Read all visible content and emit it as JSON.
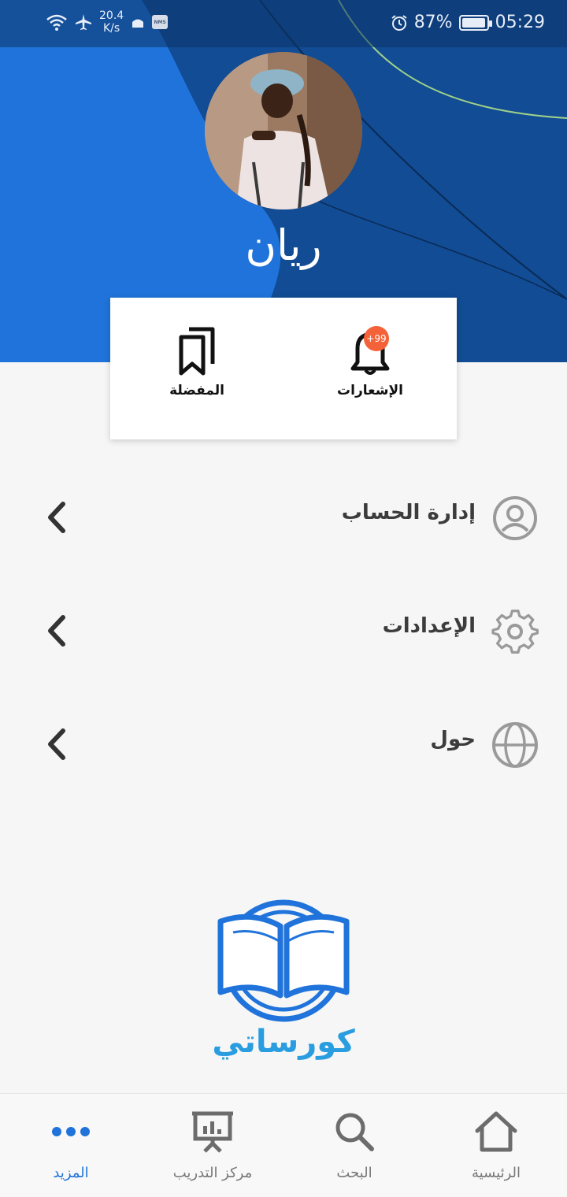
{
  "status_bar": {
    "speed_value": "20.4",
    "speed_unit": "K/s",
    "battery": "87%",
    "time": "05:29"
  },
  "profile": {
    "name": "ريان"
  },
  "quick_actions": {
    "favorites_label": "المفضلة",
    "notifications_label": "الإشعارات",
    "notifications_badge": "+99"
  },
  "menu": {
    "items": [
      {
        "label": "إدارة الحساب",
        "icon": "account-circle-icon"
      },
      {
        "label": "الإعدادات",
        "icon": "gear-icon"
      },
      {
        "label": "حول",
        "icon": "globe-icon"
      }
    ]
  },
  "brand": {
    "name": "كورساتي"
  },
  "bottom_nav": {
    "items": [
      {
        "label": "المزيد",
        "icon": "more-dots-icon",
        "active": true
      },
      {
        "label": "مركز التدريب",
        "icon": "presentation-board-icon"
      },
      {
        "label": "البحث",
        "icon": "search-icon"
      },
      {
        "label": "الرئيسية",
        "icon": "home-icon"
      }
    ]
  },
  "colors": {
    "primary": "#1f73da",
    "header_dark": "#0e3f7c",
    "badge": "#f4623a",
    "brand_text": "#2a9de0"
  }
}
